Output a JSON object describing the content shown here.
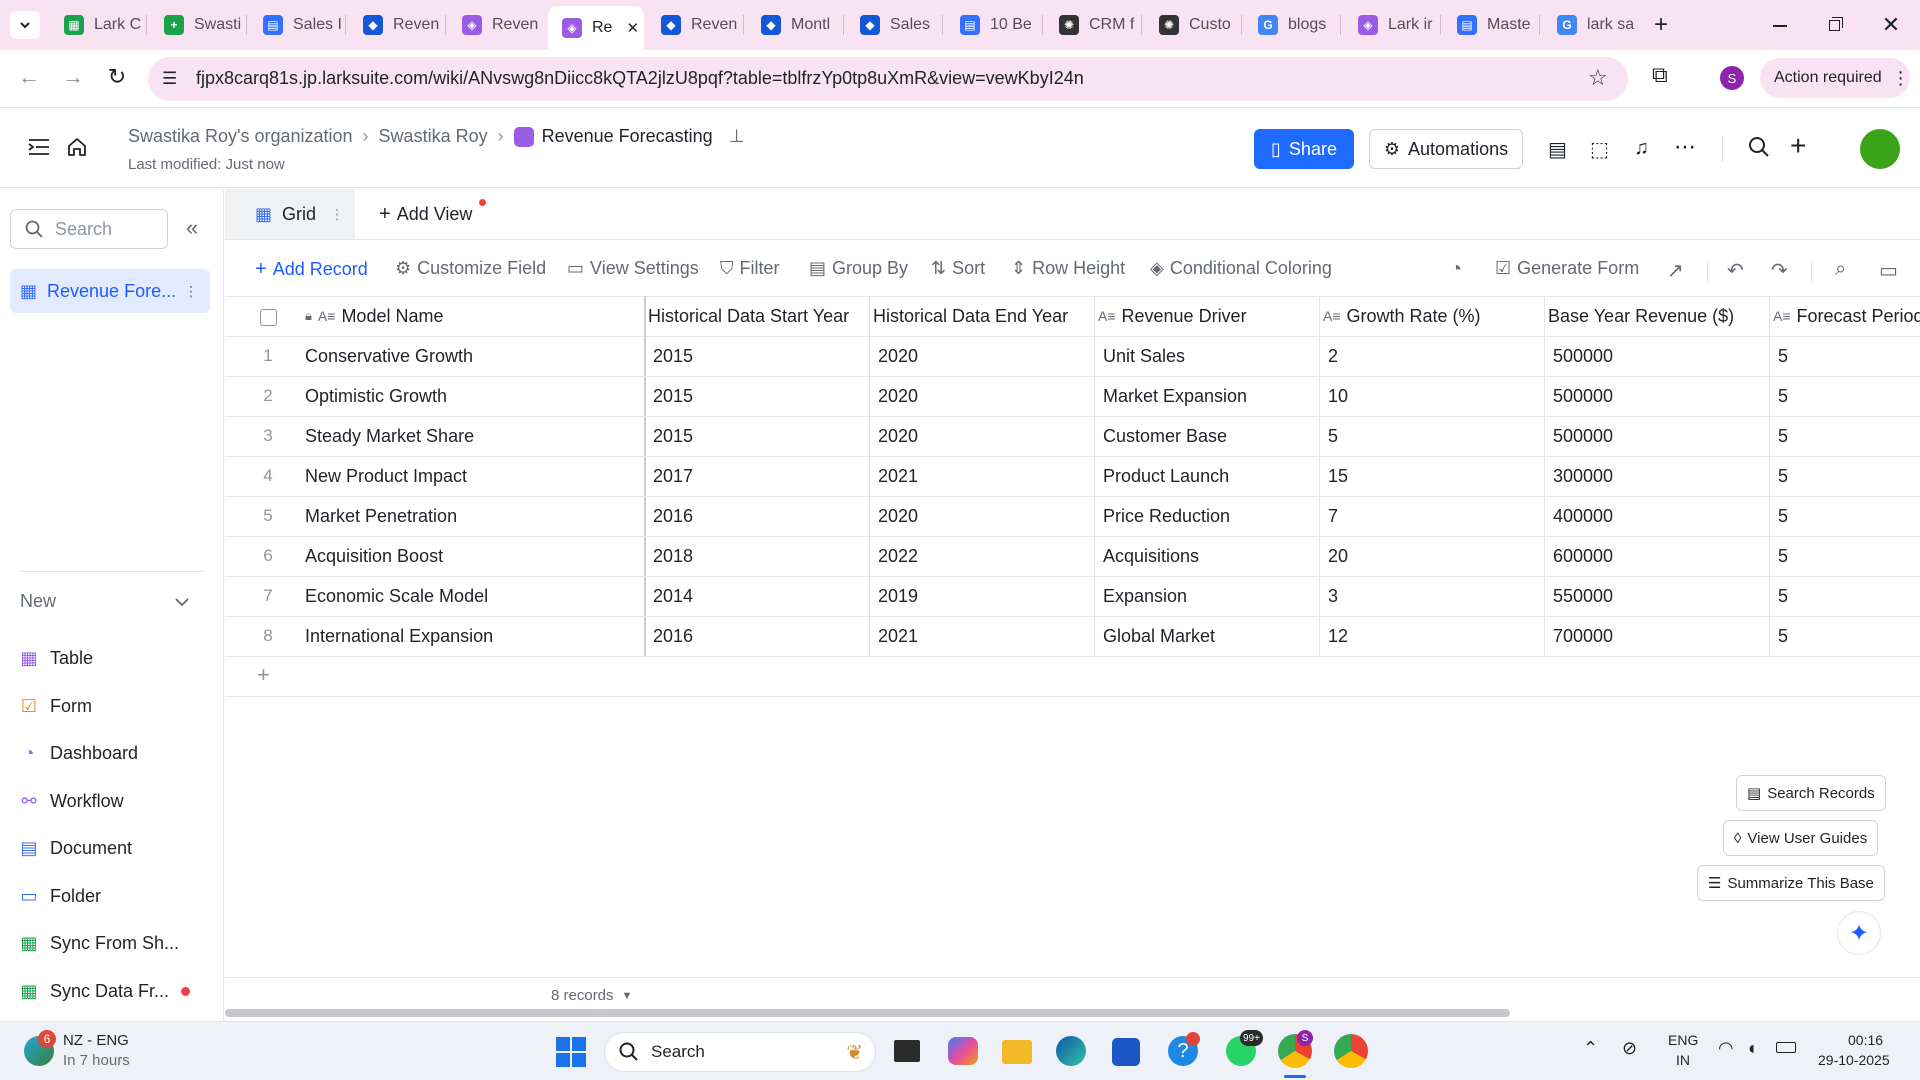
{
  "browser": {
    "tabs": [
      {
        "title": "Lark C",
        "color": "#1aa34a",
        "glyph": "▦"
      },
      {
        "title": "Swasti",
        "color": "#1aa34a",
        "glyph": "+"
      },
      {
        "title": "Sales I",
        "color": "#3370ff",
        "glyph": "▤"
      },
      {
        "title": "Reven",
        "color": "#1458d8",
        "glyph": "◆"
      },
      {
        "title": "Reven",
        "color": "#9b5de5",
        "glyph": "◈"
      },
      {
        "title": "Re",
        "color": "#9b5de5",
        "glyph": "◈"
      },
      {
        "title": "Reven",
        "color": "#1458d8",
        "glyph": "◆"
      },
      {
        "title": "Montl",
        "color": "#1458d8",
        "glyph": "◆"
      },
      {
        "title": "Sales",
        "color": "#1458d8",
        "glyph": "◆"
      },
      {
        "title": "10 Be",
        "color": "#3370ff",
        "glyph": "▤"
      },
      {
        "title": "CRM f",
        "color": "#333333",
        "glyph": "✺"
      },
      {
        "title": "Custo",
        "color": "#333333",
        "glyph": "✺"
      },
      {
        "title": "blogs",
        "color": "#4285f4",
        "glyph": "G"
      },
      {
        "title": "Lark ir",
        "color": "#9b5de5",
        "glyph": "◈"
      },
      {
        "title": "Maste",
        "color": "#3370ff",
        "glyph": "▤"
      },
      {
        "title": "lark sa",
        "color": "#4285f4",
        "glyph": "G"
      }
    ],
    "url": "fjpx8carq81s.jp.larksuite.com/wiki/ANvswg8nDiicc8kQTA2jlzU8pqf?table=tblfrzYp0tp8uXmR&view=vewKbyI24n",
    "profile_initial": "S",
    "action_required": "Action required"
  },
  "header": {
    "breadcrumb": [
      "Swastika Roy's organization",
      "Swastika Roy",
      "Revenue Forecasting"
    ],
    "last_modified": "Last modified: Just now",
    "share_label": "Share",
    "automations_label": "Automations"
  },
  "sidebar": {
    "search_placeholder": "Search",
    "active_item": "Revenue Fore...",
    "new_label": "New",
    "items": [
      {
        "label": "Table",
        "icon": "table-icon",
        "color": "#9b5de5"
      },
      {
        "label": "Form",
        "icon": "form-icon",
        "color": "#f08a24"
      },
      {
        "label": "Dashboard",
        "icon": "dashboard-icon",
        "color": "#9b5de5"
      },
      {
        "label": "Workflow",
        "icon": "workflow-icon",
        "color": "#9b5de5"
      },
      {
        "label": "Document",
        "icon": "document-icon",
        "color": "#3370ff"
      },
      {
        "label": "Folder",
        "icon": "folder-icon",
        "color": "#3370ff"
      },
      {
        "label": "Sync From Sh...",
        "icon": "sheet-icon",
        "color": "#1aa34a"
      },
      {
        "label": "Sync Data Fr...",
        "icon": "sync-icon",
        "color": "#1aa34a"
      }
    ]
  },
  "views": {
    "grid_label": "Grid",
    "add_view_label": "Add View"
  },
  "toolbar": {
    "add_record": "Add Record",
    "customize_field": "Customize Field",
    "view_settings": "View Settings",
    "filter": "Filter",
    "group_by": "Group By",
    "sort": "Sort",
    "row_height": "Row Height",
    "conditional_coloring": "Conditional Coloring",
    "generate_form": "Generate Form"
  },
  "table": {
    "columns": [
      "Model Name",
      "Historical Data Start Year",
      "Historical Data End Year",
      "Revenue Driver",
      "Growth Rate (%)",
      "Base Year Revenue ($)",
      "Forecast Period"
    ],
    "rows": [
      [
        "1",
        "Conservative Growth",
        "2015",
        "2020",
        "Unit Sales",
        "2",
        "500000",
        "5"
      ],
      [
        "2",
        "Optimistic Growth",
        "2015",
        "2020",
        "Market Expansion",
        "10",
        "500000",
        "5"
      ],
      [
        "3",
        "Steady Market Share",
        "2015",
        "2020",
        "Customer Base",
        "5",
        "500000",
        "5"
      ],
      [
        "4",
        "New Product Impact",
        "2017",
        "2021",
        "Product Launch",
        "15",
        "300000",
        "5"
      ],
      [
        "5",
        "Market Penetration",
        "2016",
        "2020",
        "Price Reduction",
        "7",
        "400000",
        "5"
      ],
      [
        "6",
        "Acquisition Boost",
        "2018",
        "2022",
        "Acquisitions",
        "20",
        "600000",
        "5"
      ],
      [
        "7",
        "Economic Scale Model",
        "2014",
        "2019",
        "Expansion",
        "3",
        "550000",
        "5"
      ],
      [
        "8",
        "International Expansion",
        "2016",
        "2021",
        "Global Market",
        "12",
        "700000",
        "5"
      ]
    ],
    "record_count": "8 records"
  },
  "floating": {
    "search_records": "Search Records",
    "view_user_guides": "View User Guides",
    "summarize": "Summarize This Base"
  },
  "taskbar": {
    "weather_badge": "6",
    "weather_line1": "NZ - ENG",
    "weather_line2": "In 7 hours",
    "search_placeholder": "Search",
    "lang_line1": "ENG",
    "lang_line2": "IN",
    "time": "00:16",
    "date": "29-10-2025",
    "whatsapp_badge": "99+",
    "chrome_badge": "S"
  }
}
